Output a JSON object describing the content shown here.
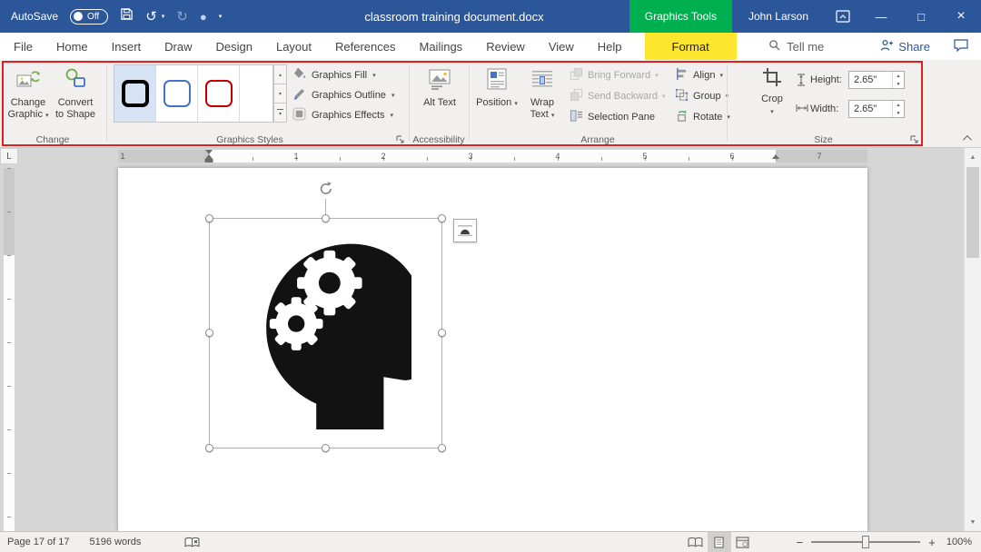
{
  "colors": {
    "titlebar_bg": "#2b579a",
    "contextual_green": "#00b050",
    "format_tab_yellow": "#ffe62e",
    "annotation_red": "#e02020",
    "accent_blue": "#2b579a"
  },
  "titlebar": {
    "autosave_label": "AutoSave",
    "autosave_state": "Off",
    "document_title": "classroom training document.docx",
    "contextual_tab_label": "Graphics Tools",
    "user_name": "John Larson"
  },
  "tabs": [
    {
      "label": "File"
    },
    {
      "label": "Home"
    },
    {
      "label": "Insert"
    },
    {
      "label": "Draw"
    },
    {
      "label": "Design"
    },
    {
      "label": "Layout"
    },
    {
      "label": "References"
    },
    {
      "label": "Mailings"
    },
    {
      "label": "Review"
    },
    {
      "label": "View"
    },
    {
      "label": "Help"
    },
    {
      "label": "Format"
    }
  ],
  "tab_row_right": {
    "tell_me": "Tell me",
    "share": "Share"
  },
  "ribbon": {
    "change": {
      "group_label": "Change",
      "change_graphic": "Change Graphic",
      "convert_to_shape": "Convert to Shape"
    },
    "graphics_styles": {
      "group_label": "Graphics Styles",
      "fill": "Graphics Fill",
      "outline": "Graphics Outline",
      "effects": "Graphics Effects"
    },
    "accessibility": {
      "group_label": "Accessibility",
      "alt_text": "Alt Text"
    },
    "arrange": {
      "group_label": "Arrange",
      "position": "Position",
      "wrap_text": "Wrap Text",
      "bring_forward": "Bring Forward",
      "send_backward": "Send Backward",
      "selection_pane": "Selection Pane",
      "align": "Align",
      "group": "Group",
      "rotate": "Rotate"
    },
    "size": {
      "group_label": "Size",
      "crop": "Crop",
      "height_label": "Height:",
      "height_value": "2.65\"",
      "width_label": "Width:",
      "width_value": "2.65\""
    }
  },
  "ruler": {
    "left_margin_number": "1",
    "numbers": [
      "1",
      "2",
      "3",
      "4",
      "5",
      "6",
      "7"
    ]
  },
  "statusbar": {
    "page_indicator": "Page 17 of 17",
    "word_count": "5196 words",
    "zoom_level": "100%"
  },
  "glyphs": {
    "dropdown": "▾",
    "undo": "↺",
    "redo": "↻",
    "touch_dot": "●",
    "minimize": "—",
    "maximize": "□",
    "close": "×",
    "gallery_up": "▴",
    "gallery_down": "▾",
    "spin_up": "▲",
    "spin_down": "▼",
    "scroll_up": "▲",
    "scroll_down": "▼",
    "zoom_out": "−",
    "zoom_in": "+",
    "tab_selector": "L"
  }
}
